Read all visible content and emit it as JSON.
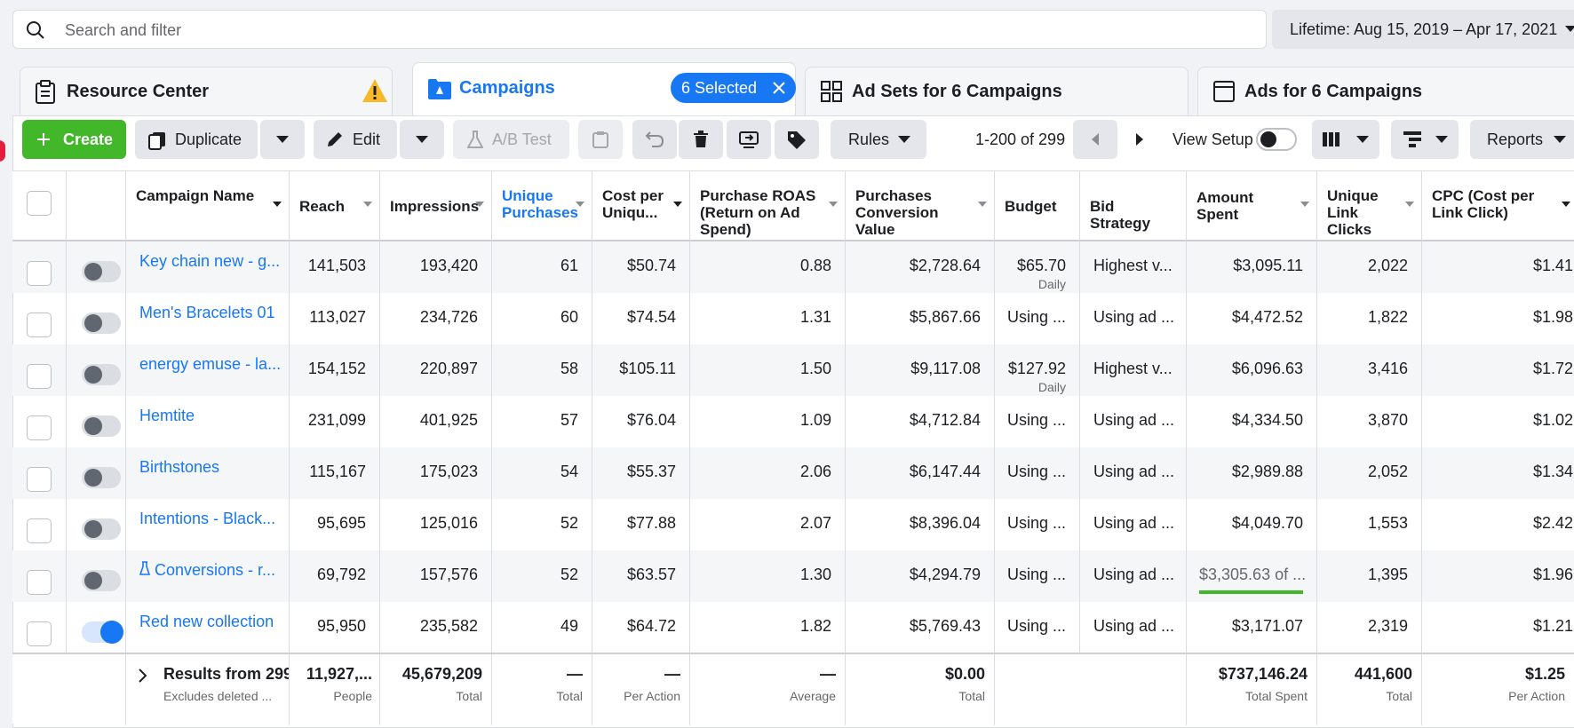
{
  "search": {
    "placeholder": "Search and filter"
  },
  "date_range": {
    "label": "Lifetime: Aug 15, 2019 – Apr 17, 2021"
  },
  "tabs": [
    {
      "label": "Resource Center"
    },
    {
      "label": "Campaigns",
      "selected_badge": "6 Selected"
    },
    {
      "label": "Ad Sets for 6 Campaigns"
    },
    {
      "label": "Ads for 6 Campaigns"
    }
  ],
  "toolbar": {
    "create": "Create",
    "duplicate": "Duplicate",
    "edit": "Edit",
    "ab_test": "A/B Test",
    "rules": "Rules",
    "pager": "1-200 of 299",
    "view_setup": "View Setup",
    "reports": "Reports"
  },
  "columns": {
    "name": "Campaign Name",
    "reach": "Reach",
    "impressions": "Impressions",
    "unique_purchases": "Unique Purchases",
    "cost_per_unique": "Cost per Uniqu...",
    "roas": "Purchase ROAS (Return on Ad Spend)",
    "conv_value": "Purchases Conversion Value",
    "budget": "Budget",
    "bid": "Bid Strategy",
    "spent": "Amount Spent",
    "unique_clicks": "Unique Link Clicks",
    "cpc": "CPC (Cost per Link Click)"
  },
  "rows": [
    {
      "name": "Key chain new - g...",
      "reach": "141,503",
      "impr": "193,420",
      "up": "61",
      "cpu": "$50.74",
      "roas": "0.88",
      "cv": "$2,728.64",
      "budget": "$65.70",
      "budget_sub": "Daily",
      "bid": "Highest v...",
      "spent": "$3,095.11",
      "clicks": "2,022",
      "cpc": "$1.41",
      "on": false
    },
    {
      "name": "Men's Bracelets 01",
      "reach": "113,027",
      "impr": "234,726",
      "up": "60",
      "cpu": "$74.54",
      "roas": "1.31",
      "cv": "$5,867.66",
      "budget": "Using ...",
      "budget_sub": "",
      "bid": "Using ad ...",
      "spent": "$4,472.52",
      "clicks": "1,822",
      "cpc": "$1.98",
      "on": false
    },
    {
      "name": "energy emuse - la...",
      "reach": "154,152",
      "impr": "220,897",
      "up": "58",
      "cpu": "$105.11",
      "roas": "1.50",
      "cv": "$9,117.08",
      "budget": "$127.92",
      "budget_sub": "Daily",
      "bid": "Highest v...",
      "spent": "$6,096.63",
      "clicks": "3,416",
      "cpc": "$1.72",
      "on": false
    },
    {
      "name": "Hemtite",
      "reach": "231,099",
      "impr": "401,925",
      "up": "57",
      "cpu": "$76.04",
      "roas": "1.09",
      "cv": "$4,712.84",
      "budget": "Using ...",
      "budget_sub": "",
      "bid": "Using ad ...",
      "spent": "$4,334.50",
      "clicks": "3,870",
      "cpc": "$1.02",
      "on": false
    },
    {
      "name": "Birthstones",
      "reach": "115,167",
      "impr": "175,023",
      "up": "54",
      "cpu": "$55.37",
      "roas": "2.06",
      "cv": "$6,147.44",
      "budget": "Using ...",
      "budget_sub": "",
      "bid": "Using ad ...",
      "spent": "$2,989.88",
      "clicks": "2,052",
      "cpc": "$1.34",
      "on": false
    },
    {
      "name": "Intentions - Black...",
      "reach": "95,695",
      "impr": "125,016",
      "up": "52",
      "cpu": "$77.88",
      "roas": "2.07",
      "cv": "$8,396.04",
      "budget": "Using ...",
      "budget_sub": "",
      "bid": "Using ad ...",
      "spent": "$4,049.70",
      "clicks": "1,553",
      "cpc": "$2.42",
      "on": false
    },
    {
      "name": "Conversions - r...",
      "reach": "69,792",
      "impr": "157,576",
      "up": "52",
      "cpu": "$63.57",
      "roas": "1.30",
      "cv": "$4,294.79",
      "budget": "Using ...",
      "budget_sub": "",
      "bid": "Using ad ...",
      "spent": "$3,305.63 of ...",
      "clicks": "1,395",
      "cpc": "$1.96",
      "on": false,
      "flask": true
    },
    {
      "name": "Red new collection",
      "reach": "95,950",
      "impr": "235,582",
      "up": "49",
      "cpu": "$64.72",
      "roas": "1.82",
      "cv": "$5,769.43",
      "budget": "Using ...",
      "budget_sub": "",
      "bid": "Using ad ...",
      "spent": "$3,171.07",
      "clicks": "2,319",
      "cpc": "$1.21",
      "on": true
    }
  ],
  "footer": {
    "results": "Results from 299",
    "excludes": "Excludes deleted ...",
    "reach": {
      "v": "11,927,...",
      "s": "People"
    },
    "impr": {
      "v": "45,679,209",
      "s": "Total"
    },
    "up": {
      "v": "—",
      "s": "Total"
    },
    "cpu": {
      "v": "—",
      "s": "Per Action"
    },
    "roas": {
      "v": "—",
      "s": "Average"
    },
    "cv": {
      "v": "$0.00",
      "s": "Total"
    },
    "spent": {
      "v": "$737,146.24",
      "s": "Total Spent"
    },
    "clicks": {
      "v": "441,600",
      "s": "Total"
    },
    "cpc": {
      "v": "$1.25",
      "s": "Per Action"
    }
  },
  "colors": {
    "accent": "#1877f2",
    "create": "#42b72a",
    "warning": "#f7b928"
  }
}
